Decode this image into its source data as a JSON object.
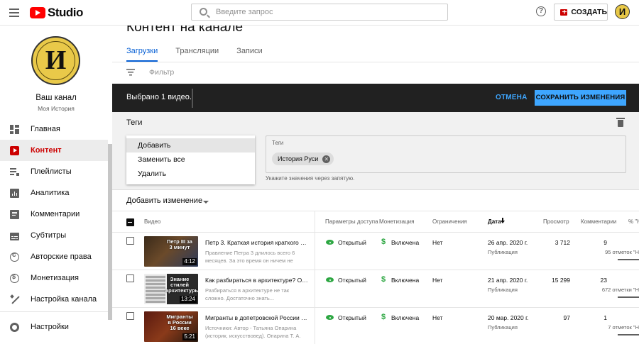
{
  "header": {
    "logo_text": "Studio",
    "search_placeholder": "Введите запрос",
    "help_symbol": "?",
    "create_label": "СОЗДАТЬ",
    "avatar_letter": "И",
    "brand_color": "#ff0000"
  },
  "sidebar": {
    "avatar_letter": "И",
    "channel_name": "Ваш канал",
    "channel_subtitle": "Моя История",
    "items": [
      {
        "label": "Главная",
        "icon": "dashboard-icon"
      },
      {
        "label": "Контент",
        "icon": "content-icon",
        "active": true
      },
      {
        "label": "Плейлисты",
        "icon": "playlist-icon"
      },
      {
        "label": "Аналитика",
        "icon": "analytics-icon"
      },
      {
        "label": "Комментарии",
        "icon": "comments-icon"
      },
      {
        "label": "Субтитры",
        "icon": "subtitles-icon"
      },
      {
        "label": "Авторские права",
        "icon": "copyright-icon"
      },
      {
        "label": "Монетизация",
        "icon": "monetization-icon"
      },
      {
        "label": "Настройка канала",
        "icon": "customization-icon"
      }
    ],
    "settings_label": "Настройки"
  },
  "main": {
    "title": "Контент на канале",
    "tabs": [
      {
        "label": "Загрузки",
        "active": true
      },
      {
        "label": "Трансляции"
      },
      {
        "label": "Записи"
      }
    ],
    "filter_placeholder": "Фильтр"
  },
  "selection_bar": {
    "selected_text": "Выбрано 1 видео.",
    "cancel_label": "ОТМЕНА",
    "save_label": "СОХРАНИТЬ ИЗМЕНЕНИЯ",
    "accent_color": "#3ea6ff"
  },
  "edit_panel": {
    "heading": "Теги",
    "menu": [
      "Добавить",
      "Заменить все",
      "Удалить"
    ],
    "tags_field_label": "Теги",
    "tag_chip": "История Руси",
    "hint": "Укажите значения через запятую.",
    "add_change_label": "Добавить изменение"
  },
  "table": {
    "headers": {
      "video": "Видео",
      "visibility": "Параметры доступа",
      "monetization": "Монетизация",
      "restrictions": "Ограничения",
      "date": "Дата",
      "views": "Просмотр",
      "comments": "Комментарии",
      "likes": "% \"Н"
    },
    "rows": [
      {
        "thumb_text": "Петр III за 3 минут",
        "duration": "4:12",
        "title": "Петр 3. Краткая история краткого правления",
        "description": "Правление Петра 3 длилось всего 6 месяцев. За это время он ничем не",
        "visibility": "Открытый",
        "monetization": "Включена",
        "restrictions": "Нет",
        "date": "26 апр. 2020 г.",
        "date_sub": "Публикация",
        "views": "3 712",
        "comments": "9",
        "likes": "95 отметок \"Н"
      },
      {
        "thumb_text": "Знание стилей архитектуры",
        "duration": "13:24",
        "title": "Как разбираться в архитектуре? Основные стили",
        "description": "Разбираться в архитектуре не так сложно. Достаточно знать...",
        "visibility": "Открытый",
        "monetization": "Включена",
        "restrictions": "Нет",
        "date": "21 апр. 2020 г.",
        "date_sub": "Публикация",
        "views": "15 299",
        "comments": "23",
        "likes": "672 отметки \"Н"
      },
      {
        "thumb_text": "Мигранты в России 16 веке",
        "duration": "5:21",
        "title": "Мигранты в допетровской России XVI века",
        "description": "Источники: Автор - Татьяна Опарина (историк, искусствовед). Опарина Т. А.",
        "visibility": "Открытый",
        "monetization": "Включена",
        "restrictions": "Нет",
        "date": "20 мар. 2020 г.",
        "date_sub": "Публикация",
        "views": "97",
        "comments": "1",
        "likes": "7 отметок \"Н"
      }
    ]
  }
}
